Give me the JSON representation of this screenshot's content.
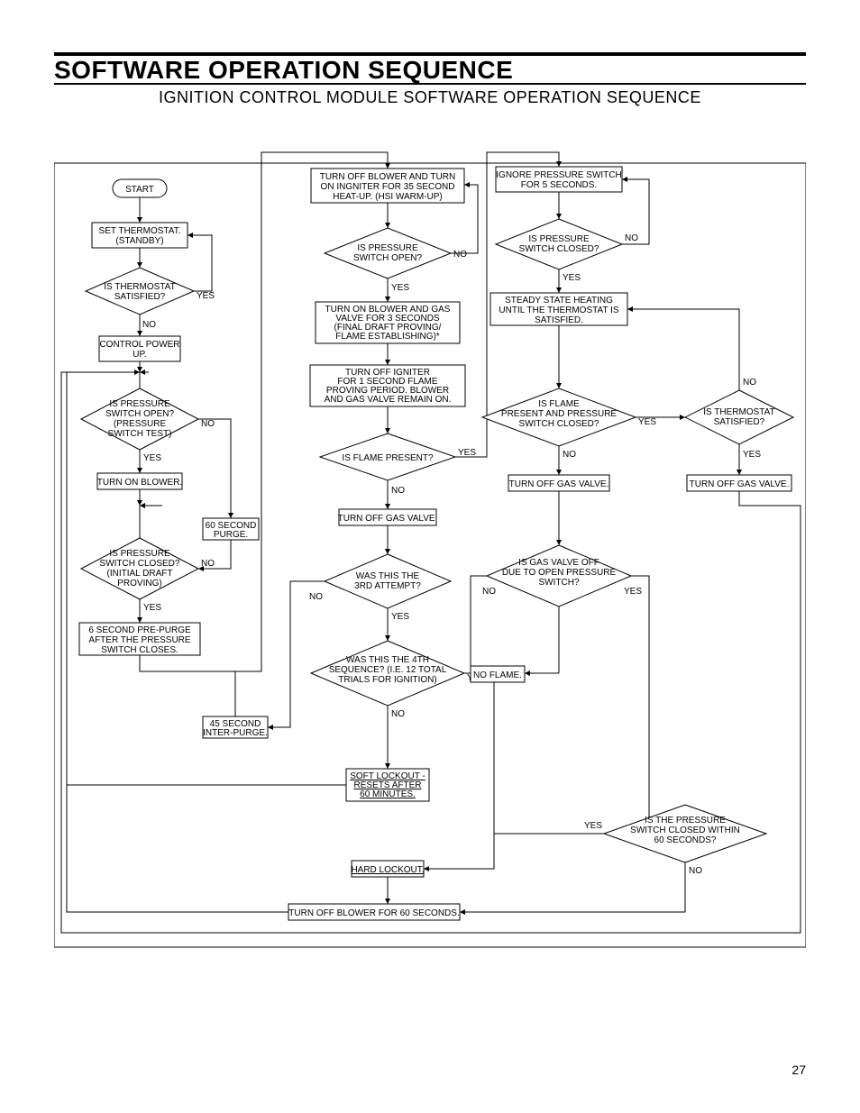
{
  "header": {
    "title": "SOFTWARE OPERATION SEQUENCE",
    "subtitle": "IGNITION CONTROL MODULE SOFTWARE OPERATION SEQUENCE"
  },
  "pagenum": "27",
  "yn": {
    "YES": "YES",
    "NO": "NO"
  },
  "n": {
    "start": "START",
    "set_th1": "SET THERMOSTAT.",
    "set_th2": "(STANDBY)",
    "th_sat": "IS THERMOSTAT",
    "th_sat2": "SATISFIED?",
    "ctrl_pu1": "CONTROL POWER",
    "ctrl_pu2": "UP.",
    "ps_open1": "IS PRESSURE",
    "ps_open2": "SWITCH OPEN?",
    "ps_open3": "(PRESSURE",
    "ps_open4": "SWITCH TEST)",
    "ton_blower": "TURN ON BLOWER.",
    "purge60a": "60 SECOND",
    "purge60b": "PURGE.",
    "ps_closed1": "IS PRESSURE",
    "ps_closed2": "SWITCH CLOSED?",
    "ps_closed3": "(INITIAL DRAFT",
    "ps_closed4": "PROVING)",
    "prepurge1": "6 SECOND PRE-PURGE",
    "prepurge2": "AFTER THE PRESSURE",
    "prepurge3": "SWITCH CLOSES.",
    "interpurge1": "45 SECOND",
    "interpurge2": "INTER-PURGE.",
    "igniter1": "TURN OFF BLOWER AND TURN",
    "igniter2": "ON INGNITER FOR 35 SECOND",
    "igniter3": "HEAT-UP. (HSI WARM-UP)",
    "ps_open_b1": "IS PRESSURE",
    "ps_open_b2": "SWITCH OPEN?",
    "gas3s1": "TURN ON BLOWER AND GAS",
    "gas3s2": "VALVE FOR 3 SECONDS",
    "gas3s3": "(FINAL DRAFT PROVING/",
    "gas3s4": "FLAME ESTABLISHING)*",
    "offign1": "TURN OFF IGNITER",
    "offign2": "FOR 1 SECOND FLAME",
    "offign3": "PROVING PERIOD. BLOWER",
    "offign4": "AND GAS VALVE REMAIN ON.",
    "flame": "IS FLAME PRESENT?",
    "offgas": "TURN OFF GAS VALVE.",
    "was3rd1": "WAS THIS THE",
    "was3rd2": "3RD ATTEMPT?",
    "was4th1": "WAS THIS THE 4TH",
    "was4th2": "SEQUENCE? (I.E. 12 TOTAL",
    "was4th3": "TRIALS FOR IGNITION)",
    "softlock1": "SOFT LOCKOUT -",
    "softlock2": "RESETS AFTER",
    "softlock3": "60 MINUTES.",
    "hardlock": "HARD LOCKOUT.",
    "blower60": "TURN OFF BLOWER FOR 60 SECONDS.",
    "ignore1": "IGNORE PRESSURE SWITCH",
    "ignore2": "FOR 5 SECONDS.",
    "ps_closed_b1": "IS PRESSURE",
    "ps_closed_b2": "SWITCH CLOSED?",
    "steady1": "STEADY STATE HEATING",
    "steady2": "UNTIL THE THERMOSTAT IS",
    "steady3": "SATISFIED.",
    "flame_ps1": "IS FLAME",
    "flame_ps2": "PRESENT AND PRESSURE",
    "flame_ps3": "SWITCH CLOSED?",
    "gasoff_ps1": "IS GAS VALVE OFF",
    "gasoff_ps2": "DUE TO OPEN PRESSURE",
    "gasoff_ps3": "SWITCH?",
    "noflame": "NO FLAME.",
    "ps60s1": "IS THE PRESSURE",
    "ps60s2": "SWITCH CLOSED WITHIN",
    "ps60s3": "60 SECONDS?",
    "th_sat_r1": "IS THERMOSTAT",
    "th_sat_r2": "SATISFIED?",
    "offgas_r": "TURN OFF GAS VALVE."
  }
}
